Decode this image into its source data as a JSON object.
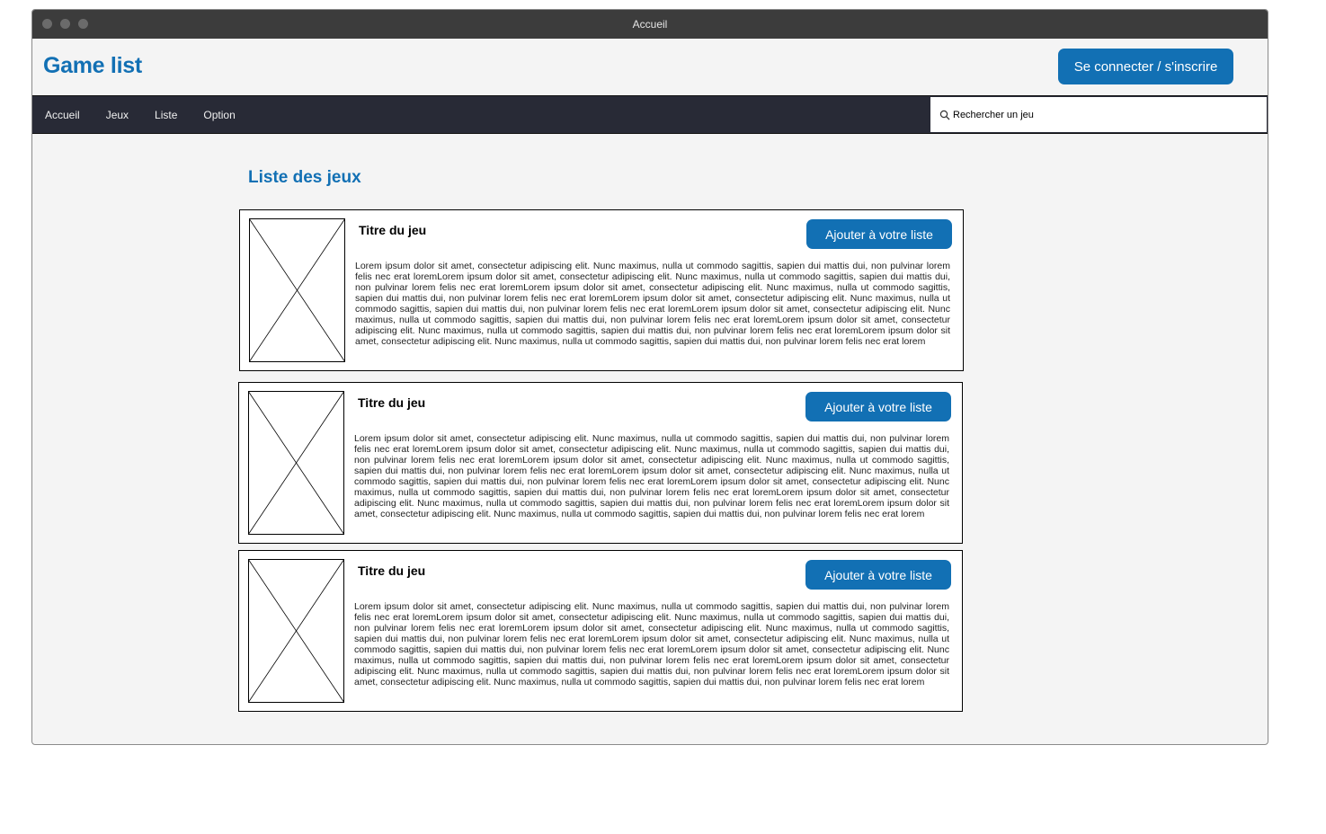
{
  "window": {
    "title": "Accueil"
  },
  "header": {
    "logo": "Game list",
    "login_label": "Se connecter / s'inscrire"
  },
  "nav": {
    "items": [
      {
        "label": "Accueil"
      },
      {
        "label": "Jeux"
      },
      {
        "label": "Liste"
      },
      {
        "label": "Option"
      }
    ],
    "search_placeholder": "Rechercher un jeu"
  },
  "main": {
    "title": "Liste des jeux",
    "games": [
      {
        "title": "Titre du jeu",
        "button": "Ajouter à votre liste",
        "description": "Lorem ipsum dolor sit amet, consectetur adipiscing elit. Nunc maximus, nulla ut commodo sagittis, sapien dui mattis dui, non pulvinar lorem felis nec erat loremLorem ipsum dolor sit amet, consectetur adipiscing elit. Nunc maximus, nulla ut commodo sagittis, sapien dui mattis dui, non pulvinar lorem felis nec erat loremLorem ipsum dolor sit amet, consectetur adipiscing elit. Nunc maximus, nulla ut commodo sagittis, sapien dui mattis dui, non pulvinar lorem felis nec erat loremLorem ipsum dolor sit amet, consectetur adipiscing elit. Nunc maximus, nulla ut commodo sagittis, sapien dui mattis dui, non pulvinar lorem felis nec erat loremLorem ipsum dolor sit amet, consectetur adipiscing elit. Nunc maximus, nulla ut commodo sagittis, sapien dui mattis dui, non pulvinar lorem felis nec erat loremLorem ipsum dolor sit amet, consectetur adipiscing elit. Nunc maximus, nulla ut commodo sagittis, sapien dui mattis dui, non pulvinar lorem felis nec erat loremLorem ipsum dolor sit amet, consectetur adipiscing elit. Nunc maximus, nulla ut commodo sagittis, sapien dui mattis dui, non pulvinar lorem felis nec erat lorem"
      },
      {
        "title": "Titre du jeu",
        "button": "Ajouter à votre liste",
        "description": "Lorem ipsum dolor sit amet, consectetur adipiscing elit. Nunc maximus, nulla ut commodo sagittis, sapien dui mattis dui, non pulvinar lorem felis nec erat loremLorem ipsum dolor sit amet, consectetur adipiscing elit. Nunc maximus, nulla ut commodo sagittis, sapien dui mattis dui, non pulvinar lorem felis nec erat loremLorem ipsum dolor sit amet, consectetur adipiscing elit. Nunc maximus, nulla ut commodo sagittis, sapien dui mattis dui, non pulvinar lorem felis nec erat loremLorem ipsum dolor sit amet, consectetur adipiscing elit. Nunc maximus, nulla ut commodo sagittis, sapien dui mattis dui, non pulvinar lorem felis nec erat loremLorem ipsum dolor sit amet, consectetur adipiscing elit. Nunc maximus, nulla ut commodo sagittis, sapien dui mattis dui, non pulvinar lorem felis nec erat loremLorem ipsum dolor sit amet, consectetur adipiscing elit. Nunc maximus, nulla ut commodo sagittis, sapien dui mattis dui, non pulvinar lorem felis nec erat loremLorem ipsum dolor sit amet, consectetur adipiscing elit. Nunc maximus, nulla ut commodo sagittis, sapien dui mattis dui, non pulvinar lorem felis nec erat lorem"
      },
      {
        "title": "Titre du jeu",
        "button": "Ajouter à votre liste",
        "description": "Lorem ipsum dolor sit amet, consectetur adipiscing elit. Nunc maximus, nulla ut commodo sagittis, sapien dui mattis dui, non pulvinar lorem felis nec erat loremLorem ipsum dolor sit amet, consectetur adipiscing elit. Nunc maximus, nulla ut commodo sagittis, sapien dui mattis dui, non pulvinar lorem felis nec erat loremLorem ipsum dolor sit amet, consectetur adipiscing elit. Nunc maximus, nulla ut commodo sagittis, sapien dui mattis dui, non pulvinar lorem felis nec erat loremLorem ipsum dolor sit amet, consectetur adipiscing elit. Nunc maximus, nulla ut commodo sagittis, sapien dui mattis dui, non pulvinar lorem felis nec erat loremLorem ipsum dolor sit amet, consectetur adipiscing elit. Nunc maximus, nulla ut commodo sagittis, sapien dui mattis dui, non pulvinar lorem felis nec erat loremLorem ipsum dolor sit amet, consectetur adipiscing elit. Nunc maximus, nulla ut commodo sagittis, sapien dui mattis dui, non pulvinar lorem felis nec erat loremLorem ipsum dolor sit amet, consectetur adipiscing elit. Nunc maximus, nulla ut commodo sagittis, sapien dui mattis dui, non pulvinar lorem felis nec erat lorem"
      }
    ]
  },
  "colors": {
    "accent": "#1270b4",
    "navbar": "#282a36",
    "titlebar": "#3c3c3c",
    "page_bg": "#f4f4f4"
  },
  "icons": {
    "search": "search-icon",
    "placeholder": "image-placeholder-icon"
  }
}
